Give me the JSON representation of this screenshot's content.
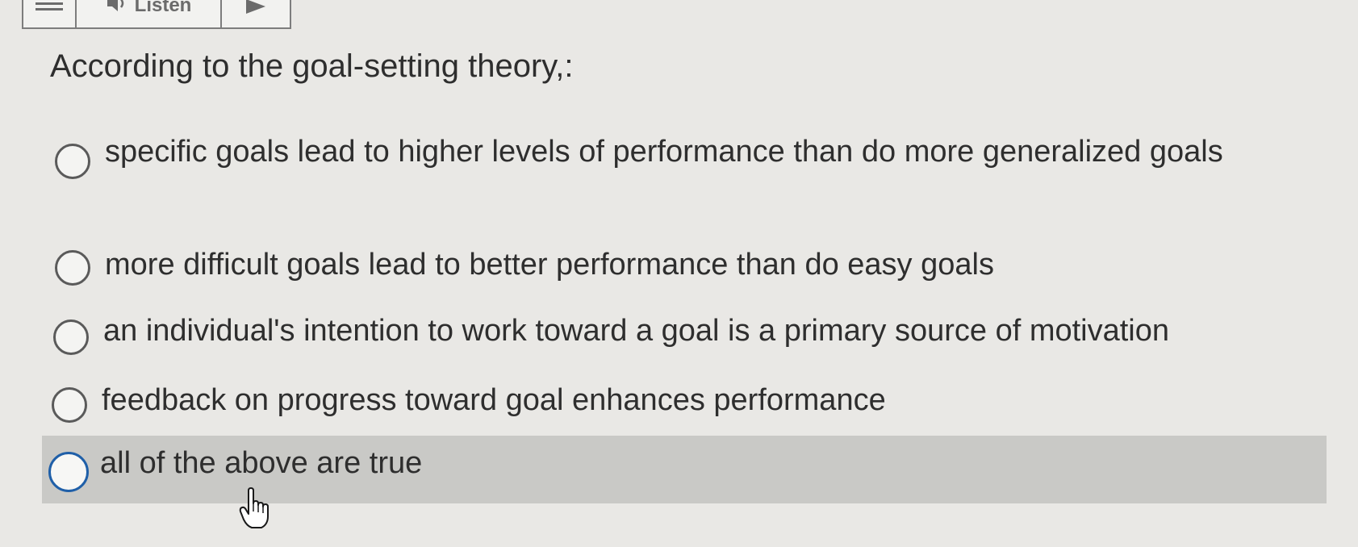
{
  "toolbar": {
    "listen_label": "Listen",
    "icons": [
      "menu-icon",
      "speaker-icon",
      "play-icon"
    ]
  },
  "question": {
    "text": "According to the goal-setting theory,:"
  },
  "options": [
    {
      "label": "specific goals lead to higher levels of performance than do more generalized goals",
      "selected": false
    },
    {
      "label": "more difficult goals lead to better performance than do easy goals",
      "selected": false
    },
    {
      "label": "an individual's intention to work toward a goal is a primary source of motivation",
      "selected": false
    },
    {
      "label": "feedback on progress toward goal enhances performance",
      "selected": false
    },
    {
      "label": "all of the above are true",
      "selected": false,
      "hovered": true
    }
  ],
  "colors": {
    "background": "#e9e8e5",
    "hover_row": "#c9c9c6",
    "focus_radio": "#1f5fa8",
    "text": "#2e2e2e"
  }
}
